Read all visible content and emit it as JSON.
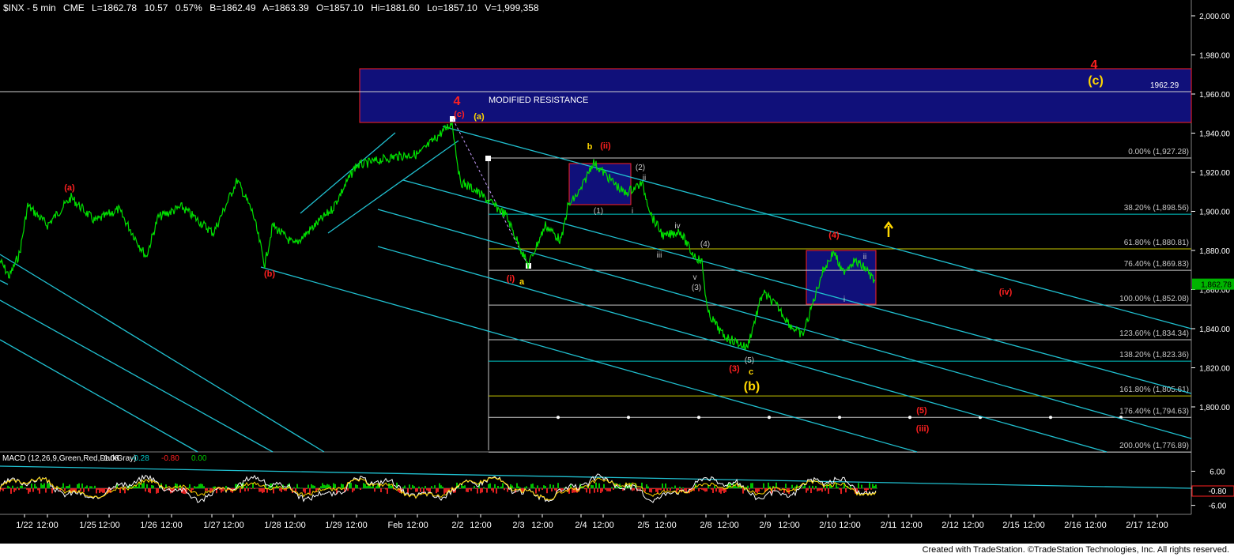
{
  "header": {
    "symbol": "$INX - 5 min",
    "exchange": "CME",
    "last": "L=1862.78",
    "change": "10.57",
    "change_pct": "0.57%",
    "bid": "B=1862.49",
    "ask": "A=1863.39",
    "open": "O=1857.10",
    "high": "Hi=1881.60",
    "low": "Lo=1857.10",
    "volume": "V=1,999,358"
  },
  "footer": {
    "credit": "Created with TradeStation. ©TradeStation Technologies, Inc. All rights reserved."
  },
  "chart_data": {
    "type": "line",
    "price_axis": {
      "ticks": [
        "2,000.00",
        "1,980.00",
        "1,960.00",
        "1,940.00",
        "1,920.00",
        "1,900.00",
        "1,880.00",
        "1,860.00",
        "1,840.00",
        "1,820.00",
        "1,800.00"
      ],
      "last_label": "1,862.78"
    },
    "time_axis": {
      "ticks": [
        "1/22",
        "12:00",
        "1/25",
        "12:00",
        "1/26",
        "12:00",
        "1/27",
        "12:00",
        "1/28",
        "12:00",
        "1/29",
        "12:00",
        "Feb",
        "12:00",
        "2/2",
        "12:00",
        "2/3",
        "12:00",
        "2/4",
        "12:00",
        "2/5",
        "12:00",
        "2/8",
        "12:00",
        "2/9",
        "12:00",
        "2/10",
        "12:00",
        "2/11",
        "12:00",
        "2/12",
        "12:00",
        "2/15",
        "12:00",
        "2/16",
        "12:00",
        "2/17",
        "12:00"
      ]
    },
    "fib_levels": [
      {
        "label": "0.00% (1,927.28)",
        "value": 1927.28,
        "color": "#c8c8c8"
      },
      {
        "label": "38.20% (1,898.56)",
        "value": 1898.56,
        "color": "#00c8c8"
      },
      {
        "label": "61.80% (1,880.81)",
        "value": 1880.81,
        "color": "#c8c800"
      },
      {
        "label": "76.40% (1,869.83)",
        "value": 1869.83,
        "color": "#c8c8c8"
      },
      {
        "label": "100.00% (1,852.08)",
        "value": 1852.08,
        "color": "#c8c8c8"
      },
      {
        "label": "123.60% (1,834.34)",
        "value": 1834.34,
        "color": "#c8c8c8"
      },
      {
        "label": "138.20% (1,823.36)",
        "value": 1823.36,
        "color": "#00c8c8"
      },
      {
        "label": "161.80% (1,805.61)",
        "value": 1805.61,
        "color": "#c8c800"
      },
      {
        "label": "176.40% (1,794.63)",
        "value": 1794.63,
        "color": "#c8c8c8"
      },
      {
        "label": "200.00% (1,776.89)",
        "value": 1776.89,
        "color": "#c8c8c8"
      }
    ],
    "resistance": {
      "label": "MODIFIED RESISTANCE",
      "target": "1962.29"
    },
    "wave_labels": [
      {
        "text": "4",
        "color": "#ff2020",
        "big": true
      },
      {
        "text": "(a)",
        "color": "#ffd700"
      },
      {
        "text": "(c)",
        "color": "#ff2020"
      },
      {
        "text": "(a)",
        "color": "#ff2020"
      },
      {
        "text": "(b)",
        "color": "#ff2020"
      },
      {
        "text": "b",
        "color": "#ffd700"
      },
      {
        "text": "(ii)",
        "color": "#ff2020"
      },
      {
        "text": "(2)",
        "color": "#c8c8c8"
      },
      {
        "text": "(1)",
        "color": "#c8c8c8"
      },
      {
        "text": "i",
        "color": "#c8c8c8"
      },
      {
        "text": "ii",
        "color": "#c8c8c8"
      },
      {
        "text": "iv",
        "color": "#c8c8c8"
      },
      {
        "text": "iii",
        "color": "#c8c8c8"
      },
      {
        "text": "(4)",
        "color": "#c8c8c8"
      },
      {
        "text": "v",
        "color": "#c8c8c8"
      },
      {
        "text": "(3)",
        "color": "#c8c8c8"
      },
      {
        "text": "(i)",
        "color": "#ff2020"
      },
      {
        "text": "a",
        "color": "#ffd700"
      },
      {
        "text": "(5)",
        "color": "#c8c8c8"
      },
      {
        "text": "(3)",
        "color": "#ff2020"
      },
      {
        "text": "c",
        "color": "#ffd700"
      },
      {
        "text": "(b)",
        "color": "#ffd700",
        "big": true
      },
      {
        "text": "(4)",
        "color": "#ff2020"
      },
      {
        "text": "ii",
        "color": "#c8c8c8"
      },
      {
        "text": "i",
        "color": "#c8c8c8"
      },
      {
        "text": "(iv)",
        "color": "#ff2020"
      },
      {
        "text": "(5)",
        "color": "#ff2020"
      },
      {
        "text": "(iii)",
        "color": "#ff2020"
      },
      {
        "text": "4",
        "color": "#ff2020",
        "big": true
      },
      {
        "text": "(c)",
        "color": "#ffd700",
        "big": true
      }
    ],
    "macd": {
      "title": "MACD (12,26,9,Green,Red,DarkGray)",
      "values": [
        {
          "text": "-1.08",
          "color": "#ffffff"
        },
        {
          "text": "-0.28",
          "color": "#00c8c8"
        },
        {
          "text": "-0.80",
          "color": "#ff2020"
        },
        {
          "text": "0.00",
          "color": "#00c800"
        }
      ],
      "ticks": [
        "0.00",
        "6.00",
        "-6.00"
      ],
      "last_label": "-0.80"
    }
  }
}
